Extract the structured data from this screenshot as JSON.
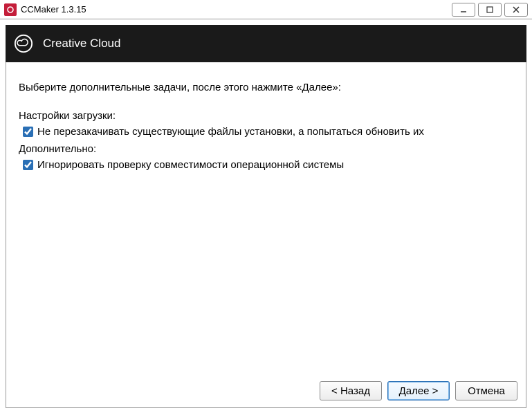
{
  "titlebar": {
    "app_title": "CCMaker 1.3.15"
  },
  "banner": {
    "title": "Creative Cloud"
  },
  "content": {
    "instruction": "Выберите дополнительные задачи, после этого нажмите «Далее»:",
    "group_download": "Настройки загрузки:",
    "opt_download": "Не перезакачивать существующие файлы установки, а попытаться обновить их",
    "group_additional": "Дополнительно:",
    "opt_ignore_os": "Игнорировать проверку совместимости операционной системы"
  },
  "buttons": {
    "back": "< Назад",
    "next": "Далее >",
    "cancel": "Отмена"
  }
}
